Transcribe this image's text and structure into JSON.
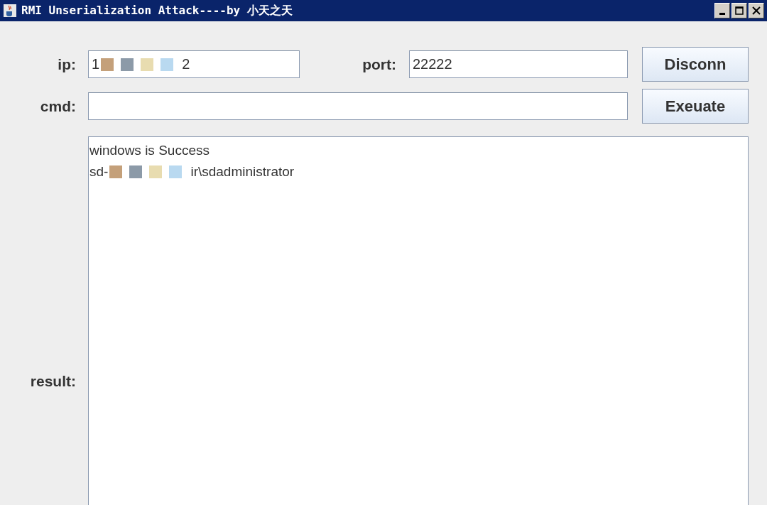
{
  "window": {
    "title": "RMI Unserialization Attack----by 小天之天"
  },
  "ip": {
    "label": "ip:",
    "parts": [
      {
        "kind": "text",
        "text": "1"
      },
      {
        "kind": "redaction"
      },
      {
        "kind": "text",
        "text": "2"
      }
    ]
  },
  "port": {
    "label": "port:",
    "value": "22222"
  },
  "cmd": {
    "label": "cmd:"
  },
  "buttons": [
    {
      "label": "Disconn"
    },
    {
      "label": "Exeuate"
    }
  ],
  "result": {
    "label": "result:",
    "lines": [
      {
        "parts": [
          {
            "kind": "text",
            "text": "windows is Success"
          }
        ]
      },
      {
        "parts": [
          {
            "kind": "text",
            "text": "sd-"
          },
          {
            "kind": "redaction"
          },
          {
            "kind": "text",
            "text": "ir\\sdadministrator"
          }
        ]
      }
    ]
  }
}
